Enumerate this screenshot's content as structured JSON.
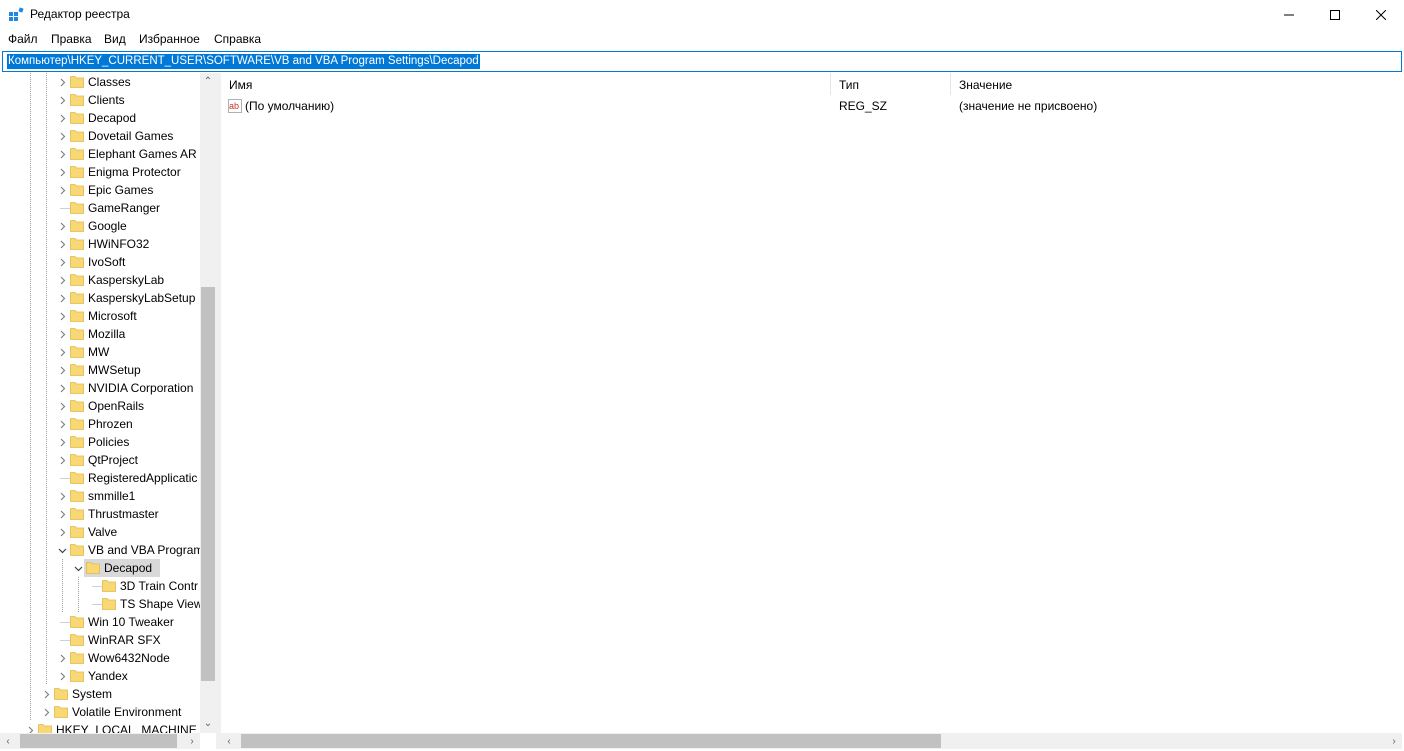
{
  "window": {
    "title": "Редактор реестра"
  },
  "menu": [
    "Файл",
    "Правка",
    "Вид",
    "Избранное",
    "Справка"
  ],
  "address": "Компьютер\\HKEY_CURRENT_USER\\SOFTWARE\\VB and VBA Program Settings\\Decapod",
  "tree": {
    "items": [
      {
        "label": "Classes",
        "level": 2,
        "state": "collapsed"
      },
      {
        "label": "Clients",
        "level": 2,
        "state": "collapsed"
      },
      {
        "label": "Decapod",
        "level": 2,
        "state": "collapsed"
      },
      {
        "label": "Dovetail Games",
        "level": 2,
        "state": "collapsed"
      },
      {
        "label": "Elephant Games AR",
        "level": 2,
        "state": "collapsed"
      },
      {
        "label": "Enigma Protector",
        "level": 2,
        "state": "collapsed"
      },
      {
        "label": "Epic Games",
        "level": 2,
        "state": "collapsed"
      },
      {
        "label": "GameRanger",
        "level": 2,
        "state": "leaf"
      },
      {
        "label": "Google",
        "level": 2,
        "state": "collapsed"
      },
      {
        "label": "HWiNFO32",
        "level": 2,
        "state": "collapsed"
      },
      {
        "label": "IvoSoft",
        "level": 2,
        "state": "collapsed"
      },
      {
        "label": "KasperskyLab",
        "level": 2,
        "state": "collapsed"
      },
      {
        "label": "KasperskyLabSetup",
        "level": 2,
        "state": "collapsed"
      },
      {
        "label": "Microsoft",
        "level": 2,
        "state": "collapsed"
      },
      {
        "label": "Mozilla",
        "level": 2,
        "state": "collapsed"
      },
      {
        "label": "MW",
        "level": 2,
        "state": "collapsed"
      },
      {
        "label": "MWSetup",
        "level": 2,
        "state": "collapsed"
      },
      {
        "label": "NVIDIA Corporation",
        "level": 2,
        "state": "collapsed"
      },
      {
        "label": "OpenRails",
        "level": 2,
        "state": "collapsed"
      },
      {
        "label": "Phrozen",
        "level": 2,
        "state": "collapsed"
      },
      {
        "label": "Policies",
        "level": 2,
        "state": "collapsed"
      },
      {
        "label": "QtProject",
        "level": 2,
        "state": "collapsed"
      },
      {
        "label": "RegisteredApplicatic",
        "level": 2,
        "state": "leaf"
      },
      {
        "label": "smmille1",
        "level": 2,
        "state": "collapsed"
      },
      {
        "label": "Thrustmaster",
        "level": 2,
        "state": "collapsed"
      },
      {
        "label": "Valve",
        "level": 2,
        "state": "collapsed"
      },
      {
        "label": "VB and VBA Program",
        "level": 2,
        "state": "expanded"
      },
      {
        "label": "Decapod",
        "level": 3,
        "state": "expanded",
        "selected": true
      },
      {
        "label": "3D Train Contr",
        "level": 4,
        "state": "leaf"
      },
      {
        "label": "TS Shape View",
        "level": 4,
        "state": "leaf"
      },
      {
        "label": "Win 10 Tweaker",
        "level": 2,
        "state": "leaf"
      },
      {
        "label": "WinRAR SFX",
        "level": 2,
        "state": "leaf"
      },
      {
        "label": "Wow6432Node",
        "level": 2,
        "state": "collapsed"
      },
      {
        "label": "Yandex",
        "level": 2,
        "state": "collapsed"
      },
      {
        "label": "System",
        "level": 1,
        "state": "collapsed"
      },
      {
        "label": "Volatile Environment",
        "level": 1,
        "state": "collapsed"
      },
      {
        "label": "HKEY_LOCAL_MACHINE",
        "level": 0,
        "state": "collapsed"
      }
    ]
  },
  "list": {
    "columns": [
      "Имя",
      "Тип",
      "Значение"
    ],
    "rows": [
      {
        "name": "(По умолчанию)",
        "type": "REG_SZ",
        "value": "(значение не присвоено)",
        "icon": "string-value-icon"
      }
    ]
  },
  "colors": {
    "accent": "#0078d7",
    "folder": "#f8d775",
    "selection": "#d9d9d9"
  }
}
